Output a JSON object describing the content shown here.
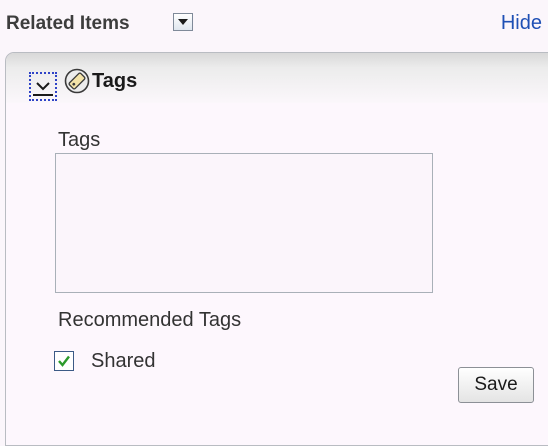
{
  "related_items": {
    "title": "Related Items",
    "hide_link": "Hide"
  },
  "panel": {
    "title": "Tags",
    "tags_label": "Tags",
    "tags_value": "",
    "recommended_label": "Recommended Tags",
    "shared_label": "Shared",
    "shared_checked": true,
    "save_label": "Save"
  },
  "icons": {
    "dropdown": "chevron-down-icon",
    "collapse": "chevron-down-icon",
    "tags": "tag-icon",
    "check": "checkmark-icon"
  },
  "colors": {
    "link": "#1f50b5",
    "focus_ring": "#2f43c7",
    "check": "#2b9a2b",
    "background": "#fbf6fb"
  }
}
